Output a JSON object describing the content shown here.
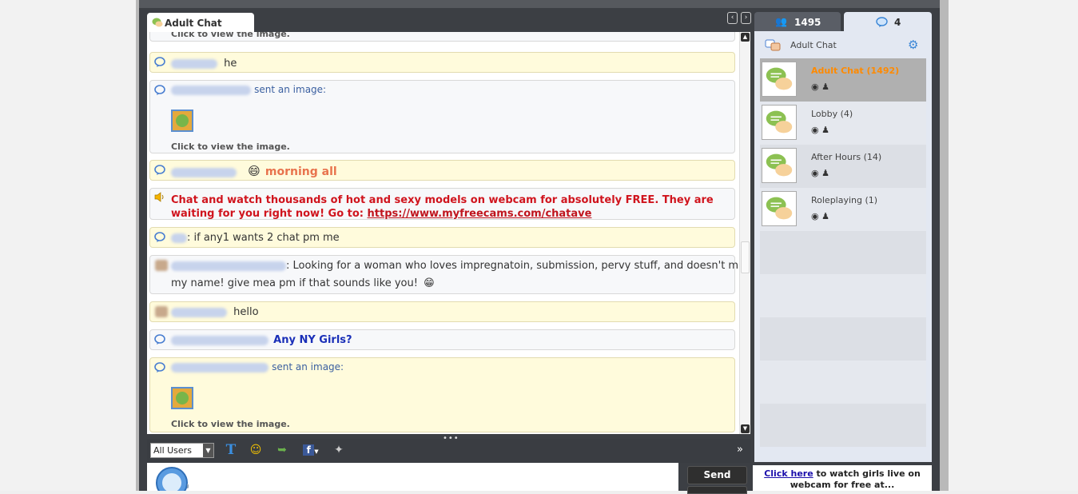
{
  "chat_tab": {
    "label": "Adult Chat"
  },
  "messages": {
    "m0_click": "Click to view the image.",
    "m1_text": "he",
    "m2_sent": "sent an image:",
    "m2_click": "Click to view the image.",
    "m3_text": "morning all",
    "m4_promo": "Chat and watch thousands of hot and sexy models on webcam for absolutely FREE.  They are waiting for you right now! Go to: ",
    "m4_link": "https://www.myfreecams.com/chatave",
    "m5_text": ": if any1 wants 2 chat pm me",
    "m6_text_a": ": Looking for a woman who loves impregnatoin, submission, pervy stuff, and doesn't mind",
    "m6_text_b": "my name! give mea  pm if that sounds like you!",
    "m7_text": "hello",
    "m8_text": "Any NY Girls?",
    "m9_sent": "sent an image:",
    "m9_click": "Click to view the image."
  },
  "toolbar": {
    "select_value": "All Users",
    "send_label": "Send"
  },
  "right_tabs": {
    "users_count": "1495",
    "rooms_count": "4"
  },
  "right_panel": {
    "header_label": "Adult Chat",
    "rooms": [
      {
        "name": "Adult Chat",
        "count": "(1492)"
      },
      {
        "name": "Lobby",
        "count": "(4)"
      },
      {
        "name": "After Hours",
        "count": "(14)"
      },
      {
        "name": "Roleplaying",
        "count": "(1)"
      }
    ]
  },
  "promo_box": {
    "link": "Click here",
    "text_a": " to watch girls live on",
    "text_b": "webcam for free at..."
  },
  "colors": {
    "accent_orange": "#ff8a00",
    "promo_red": "#d0141d",
    "message_yellow": "#fffbdc",
    "username_blue": "#1a2fb8"
  }
}
